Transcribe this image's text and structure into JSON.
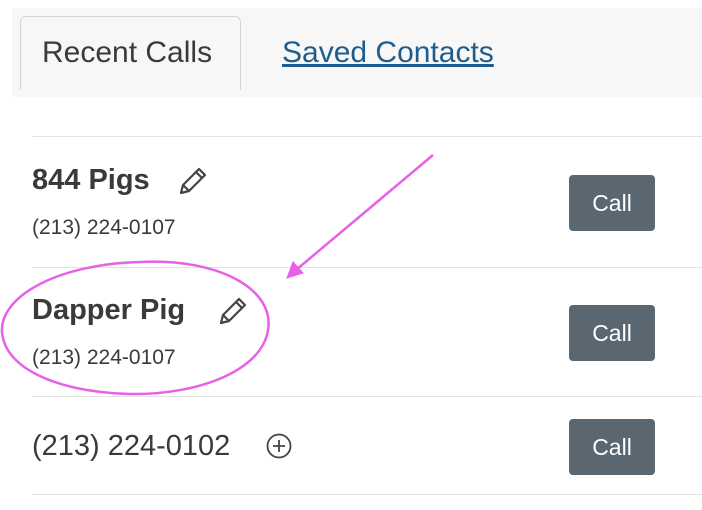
{
  "tabs": [
    {
      "label": "Recent Calls",
      "active": true
    },
    {
      "label": "Saved Contacts",
      "active": false
    }
  ],
  "calls": [
    {
      "name": "844 Pigs",
      "phone": "(213) 224-0107",
      "icon": "pencil-icon",
      "button_label": "Call"
    },
    {
      "name": "Dapper Pig",
      "phone": "(213) 224-0107",
      "icon": "pencil-icon",
      "button_label": "Call"
    },
    {
      "number": "(213) 224-0102",
      "icon": "plus-circle-icon",
      "button_label": "Call"
    }
  ],
  "colors": {
    "call_button": "#5a6770",
    "link": "#1f5d8c",
    "annotation": "#e860e8"
  }
}
